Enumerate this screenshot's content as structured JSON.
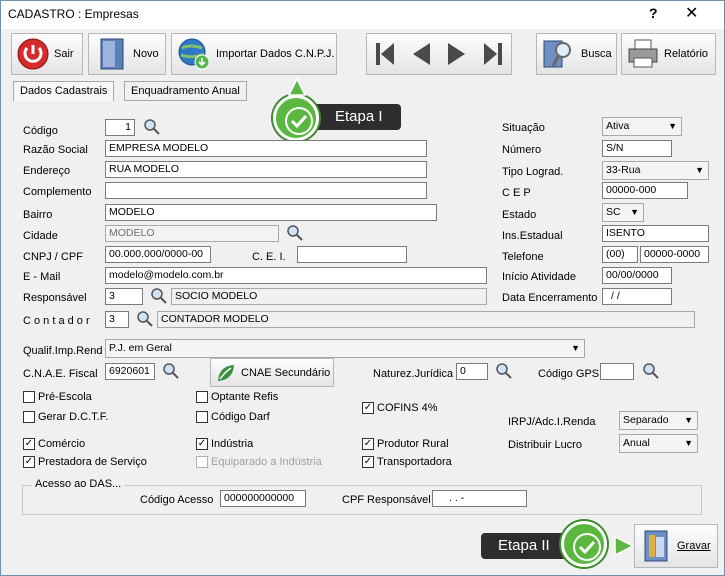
{
  "window": {
    "title": "CADASTRO : Empresas",
    "help": "?",
    "close": "✕"
  },
  "toolbar": {
    "sair": "Sair",
    "novo": "Novo",
    "importar": "Importar Dados C.N.P.J.",
    "busca": "Busca",
    "relatorio": "Relatório"
  },
  "tabs": [
    "Dados Cadastrais",
    "Enquadramento Anual"
  ],
  "callouts": {
    "etapa1": "Etapa I",
    "etapa2": "Etapa II"
  },
  "left": {
    "codigo_label": "Código",
    "codigo": "1",
    "razao_label": "Razão Social",
    "razao": "EMPRESA MODELO",
    "endereco_label": "Endereço",
    "endereco": "RUA MODELO",
    "complemento_label": "Complemento",
    "complemento": "",
    "bairro_label": "Bairro",
    "bairro": "MODELO",
    "cidade_label": "Cidade",
    "cidade": "MODELO",
    "cnpj_label": "CNPJ / CPF",
    "cnpj": "00.000.000/0000-00",
    "cei_label": "C. E. I.",
    "cei": "",
    "email_label": "E - Mail",
    "email": "modelo@modelo.com.br",
    "responsavel_label": "Responsável",
    "responsavel_cod": "3",
    "responsavel_nome": "SOCIO MODELO",
    "contador_label": "C o n t a d o r",
    "contador_cod": "3",
    "contador_nome": "CONTADOR MODELO"
  },
  "right": {
    "situacao_label": "Situação",
    "situacao": "Ativa",
    "numero_label": "Número",
    "numero": "S/N",
    "tipo_label": "Tipo Lograd.",
    "tipo": "33-Rua",
    "cep_label": "C E P",
    "cep": "00000-000",
    "estado_label": "Estado",
    "estado": "SC",
    "ie_label": "Ins.Estadual",
    "ie": "ISENTO",
    "tel_label": "Telefone",
    "tel_ddd": "(00)",
    "tel_num": "00000-0000",
    "inicio_label": "Início Atividade",
    "inicio": "00/00/0000",
    "encerramento_label": "Data Encerramento",
    "encerramento": "/ /"
  },
  "fiscal": {
    "qualif_label": "Qualif.Imp.Rend",
    "qualif": "P.J. em Geral",
    "cnae_label": "C.N.A.E. Fiscal",
    "cnae": "6920601",
    "cnae_sec": "CNAE Secundário",
    "natureza_label": "Naturez.Jurídica",
    "natureza": "0",
    "gps_label": "Código GPS",
    "gps": ""
  },
  "checks": [
    {
      "label": "Pré-Escola",
      "checked": false,
      "disabled": false
    },
    {
      "label": "Optante Refis",
      "checked": false,
      "disabled": false
    },
    {
      "label": "Gerar D.C.T.F.",
      "checked": false,
      "disabled": false
    },
    {
      "label": "Código Darf",
      "checked": false,
      "disabled": false
    },
    {
      "label": "COFINS 4%",
      "checked": true,
      "disabled": false
    },
    {
      "label": "Comércio",
      "checked": true,
      "disabled": false
    },
    {
      "label": "Indústria",
      "checked": true,
      "disabled": false
    },
    {
      "label": "Produtor Rural",
      "checked": true,
      "disabled": false
    },
    {
      "label": "Prestadora de Serviço",
      "checked": true,
      "disabled": false
    },
    {
      "label": "Equiparado a Indústria",
      "checked": false,
      "disabled": true
    },
    {
      "label": "Transportadora",
      "checked": true,
      "disabled": false
    }
  ],
  "irpj": {
    "label": "IRPJ/Adc.I.Renda",
    "value": "Separado"
  },
  "lucro": {
    "label": "Distribuir Lucro",
    "value": "Anual"
  },
  "das": {
    "legend": "Acesso ao DAS...",
    "codigo_label": "Código Acesso",
    "codigo": "000000000000",
    "cpf_label": "CPF Responsável",
    "cpf": ". . -"
  },
  "gravar": "Gravar",
  "colors": {
    "accent_green": "#5ab840",
    "callout_bg": "#2e2e2e"
  }
}
